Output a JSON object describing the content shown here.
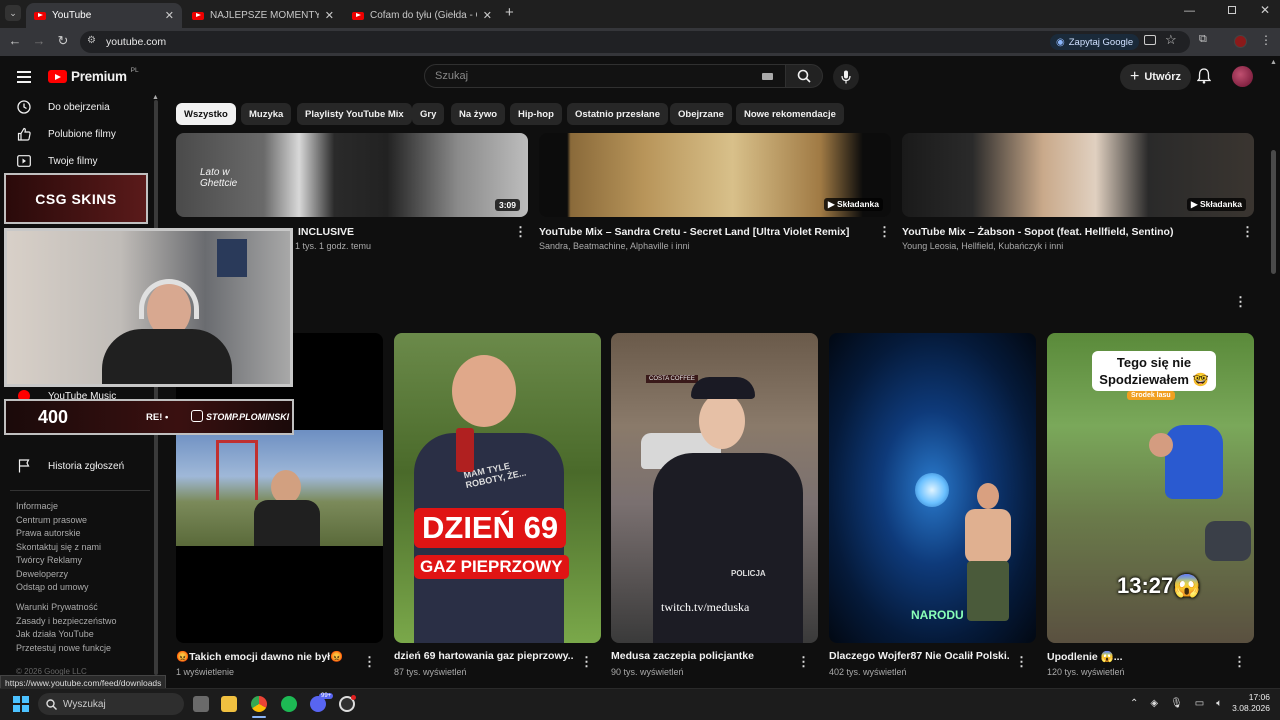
{
  "browser": {
    "tabs": [
      {
        "title": "YouTube",
        "active": true
      },
      {
        "title": "NAJLEPSZE MOMENTY POLSKIE",
        "active": false
      },
      {
        "title": "Cofam do tyłu (Giełda - Odc. 9)",
        "active": false
      }
    ],
    "url": "youtube.com",
    "ask_google_label": "Zapytaj Google",
    "status_url": "https://www.youtube.com/feed/downloads"
  },
  "header": {
    "logo_text": "Premium",
    "logo_region": "PL",
    "search_placeholder": "Szukaj",
    "create_label": "Utwórz"
  },
  "chips": [
    "Wszystko",
    "Muzyka",
    "Playlisty YouTube Mix",
    "Gry",
    "Na żywo",
    "Hip-hop",
    "Ostatnio przesłane",
    "Obejrzane",
    "Nowe rekomendacje"
  ],
  "sidebar": {
    "items": [
      {
        "label": "Do obejrzenia",
        "icon": "clock-icon"
      },
      {
        "label": "Polubione filmy",
        "icon": "thumbs-up-icon"
      },
      {
        "label": "Twoje filmy",
        "icon": "play-square-icon"
      }
    ],
    "music_item": "YouTube Music",
    "report_history": "Historia zgłoszeń",
    "footer_links_1": [
      "Informacje",
      "Centrum prasowe",
      "Prawa autorskie",
      "Skontaktuj się z nami",
      "Twórcy  Reklamy",
      "Deweloperzy",
      "Odstąp od umowy"
    ],
    "footer_links_2": [
      "Warunki  Prywatność",
      "Zasady i bezpieczeństwo",
      "Jak działa YouTube",
      "Przetestuj nowe funkcje"
    ],
    "copyright": "© 2026 Google LLC"
  },
  "overlay": {
    "sponsor": "CSG SKINS",
    "counter": "400",
    "instagram": "STOMP.PLOMINSKI",
    "ticker_fragment": "RE! •"
  },
  "row1": [
    {
      "title": "INCLUSIVE",
      "meta": "1 tys.  1 godz. temu",
      "badge": "3:09",
      "thumb_text": "Lato w Ghettcie"
    },
    {
      "title": "YouTube Mix – Sandra Cretu - Secret Land [Ultra Violet Remix]",
      "meta": "Sandra, Beatmachine, Alphaville i inni",
      "badge": "Składanka"
    },
    {
      "title": "YouTube Mix – Żabson - Sopot (feat. Hellfield, Sentino)",
      "meta": "Young Leosia, Hellfield, Kubańczyk i inni",
      "badge": "Składanka"
    }
  ],
  "shorts": [
    {
      "title": "😡Takich emocji dawno nie był😡",
      "meta": "1 wyświetlenie"
    },
    {
      "title": "dzień 69 hartowania gaz pieprzowy...",
      "meta": "87 tys. wyświetleń",
      "overlay_big": "DZIEŃ 69",
      "overlay_small": "GAZ PIEPRZOWY",
      "shirt_text": "MAM TYLE ROBOTY, ŻE..."
    },
    {
      "title": "Medusa zaczepia policjantke",
      "meta": "90 tys. wyświetleń",
      "overlay_text": "twitch.tv/meduska",
      "sign": "COSTA COFFEE",
      "badge_text": "POLICJA"
    },
    {
      "title": "Dlaczego Wojfer87 Nie Ocalił Polski...",
      "meta": "402 tys. wyświetleń",
      "overlay_text": "NARODU"
    },
    {
      "title": "Upodlenie 😱...",
      "meta": "120 tys. wyświetleń",
      "caption": "Tego się nie Spodziewałem 🤓",
      "tag": "Środek lasu",
      "timer": "13:27😱"
    }
  ],
  "taskbar": {
    "search_label": "Wyszukaj",
    "badge": "99+",
    "time": "17:06",
    "date": "3.08.2026"
  }
}
